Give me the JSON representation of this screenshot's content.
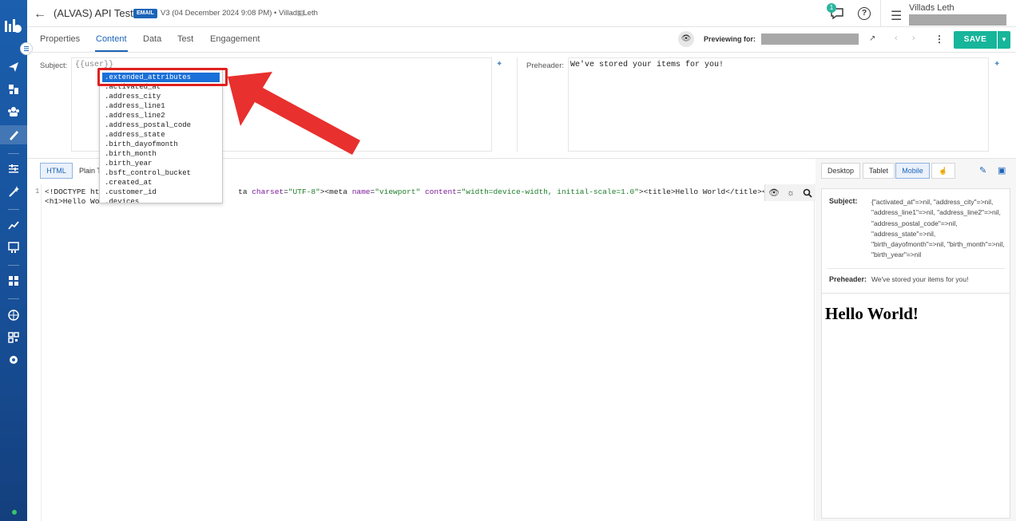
{
  "header": {
    "title": "(ALVAS) API Test",
    "badge": "EMAIL",
    "version": "V3 (04 December 2024 9:08 PM)",
    "separator": "•",
    "author": "Villads Leth",
    "notifications": "1",
    "user_name": "Villads Leth"
  },
  "tabs": [
    {
      "label": "Properties"
    },
    {
      "label": "Content"
    },
    {
      "label": "Data"
    },
    {
      "label": "Test"
    },
    {
      "label": "Engagement"
    }
  ],
  "preview": {
    "label": "Previewing for:",
    "save_label": "SAVE"
  },
  "subject": {
    "label": "Subject:",
    "value": "{{user}}"
  },
  "preheader": {
    "label": "Preheader:",
    "value": "We've stored your items for you!"
  },
  "autocomplete": {
    "items": [
      ".extended_attributes",
      ".activated_at",
      ".address_city",
      ".address_line1",
      ".address_line2",
      ".address_postal_code",
      ".address_state",
      ".birth_dayofmonth",
      ".birth_month",
      ".birth_year",
      ".bsft_control_bucket",
      ".created_at",
      ".customer_id",
      ".devices"
    ]
  },
  "editor": {
    "format_html": "HTML",
    "format_plain": "Plain T",
    "line_number": "1",
    "line1_a": "<!DOCTYPE htm",
    "line1_b": "ta ",
    "line1_attr1": "charset",
    "line1_eq1": "=",
    "line1_str1": "\"UTF-8\"",
    "line1_c": "><meta ",
    "line1_attr2": "name",
    "line1_eq2": "=",
    "line1_str2": "\"viewport\"",
    "line1_sp": " ",
    "line1_attr3": "content",
    "line1_eq3": "=",
    "line1_str3": "\"width=device-width, initial-scale=1.0\"",
    "line1_d": "><title>Hello World</title></head>",
    "line2": "<h1>Hello Wor"
  },
  "preview_panel": {
    "devices": [
      "Desktop",
      "Tablet",
      "Mobile"
    ],
    "subject_label": "Subject:",
    "subject_text": "{\"activated_at\"=>nil, \"address_city\"=>nil, \"address_line1\"=>nil, \"address_line2\"=>nil, \"address_postal_code\"=>nil, \"address_state\"=>nil, \"birth_dayofmonth\"=>nil, \"birth_month\"=>nil, \"birth_year\"=>nil",
    "preheader_label": "Preheader:",
    "preheader_text": "We've stored your items for you!",
    "heading": "Hello World!"
  },
  "colors": {
    "sidebar": "#1b5fae",
    "accent": "#1b64b8",
    "save": "#17b59a",
    "highlight": "#e02020"
  }
}
